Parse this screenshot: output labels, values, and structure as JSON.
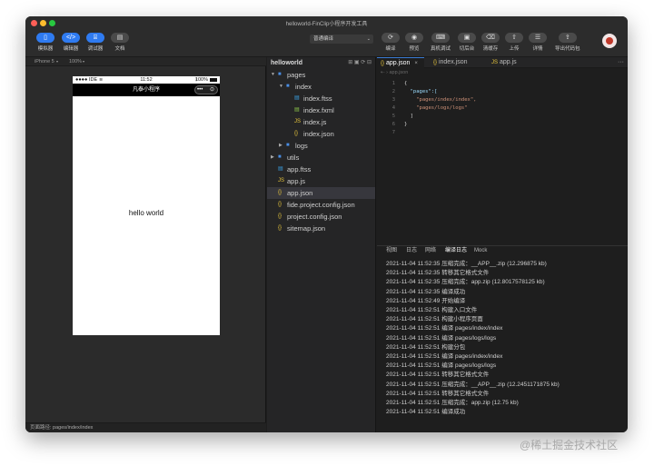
{
  "window": {
    "title": "helloworld-FinClip小程序开发工具"
  },
  "toolbar": {
    "left_buttons": [
      {
        "label": "模拟器",
        "icon": "phone-icon"
      },
      {
        "label": "编辑器",
        "icon": "code-icon"
      },
      {
        "label": "调试器",
        "icon": "debug-icon"
      },
      {
        "label": "文档",
        "icon": "doc-icon"
      }
    ],
    "compile_mode": "普通编译",
    "right_buttons": [
      {
        "label": "编译",
        "icon": "refresh-icon"
      },
      {
        "label": "预览",
        "icon": "eye-icon"
      },
      {
        "label": "真机调试",
        "icon": "device-icon"
      },
      {
        "label": "切后台",
        "icon": "background-icon"
      },
      {
        "label": "清缓存",
        "icon": "clear-icon"
      },
      {
        "label": "上传",
        "icon": "upload-icon"
      },
      {
        "label": "详情",
        "icon": "details-icon"
      },
      {
        "label": "导出代码包",
        "icon": "export-icon"
      }
    ]
  },
  "simulator": {
    "device": "iPhone 5",
    "zoom": "100%",
    "status_left": "IDE",
    "status_time": "11:52",
    "status_battery": "100%",
    "nav_title": "凡泰小程序",
    "body_text": "hello world",
    "footer_path": "页面路径: pages/index/index"
  },
  "explorer": {
    "project": "helloworld",
    "items": [
      {
        "name": "pages",
        "type": "folder",
        "indent": 0,
        "expanded": true
      },
      {
        "name": "index",
        "type": "folder",
        "indent": 1,
        "expanded": true
      },
      {
        "name": "index.ftss",
        "type": "css",
        "indent": 2
      },
      {
        "name": "index.fxml",
        "type": "xml",
        "indent": 2
      },
      {
        "name": "index.js",
        "type": "js",
        "indent": 2
      },
      {
        "name": "index.json",
        "type": "json",
        "indent": 2
      },
      {
        "name": "logs",
        "type": "folder",
        "indent": 1,
        "expanded": false
      },
      {
        "name": "utils",
        "type": "folder",
        "indent": 0,
        "expanded": false
      },
      {
        "name": "app.ftss",
        "type": "css",
        "indent": 0
      },
      {
        "name": "app.js",
        "type": "js",
        "indent": 0
      },
      {
        "name": "app.json",
        "type": "json",
        "indent": 0,
        "selected": true
      },
      {
        "name": "fide.project.config.json",
        "type": "json",
        "indent": 0
      },
      {
        "name": "project.config.json",
        "type": "json",
        "indent": 0
      },
      {
        "name": "sitemap.json",
        "type": "json",
        "indent": 0
      }
    ]
  },
  "editor": {
    "tabs": [
      {
        "label": "app.json",
        "active": true,
        "close": "×"
      },
      {
        "label": "index.json",
        "active": false
      },
      {
        "label": "app.js",
        "active": false
      }
    ],
    "breadcrumb": "app.json",
    "lines": [
      {
        "num": "1",
        "text": "{"
      },
      {
        "num": "2",
        "text": "  \"pages\":["
      },
      {
        "num": "3",
        "text": "    \"pages/index/index\","
      },
      {
        "num": "4",
        "text": "    \"pages/logs/logs\""
      },
      {
        "num": "5",
        "text": "  ]"
      },
      {
        "num": "6",
        "text": "}"
      },
      {
        "num": "7",
        "text": ""
      }
    ]
  },
  "console": {
    "tabs": [
      "视图",
      "日志",
      "网络",
      "编译日志",
      "Mock"
    ],
    "active_tab": "编译日志",
    "logs": [
      "2021-11-04 11:52:35 压缩完成：__APP__.zip (12.296875 kb)",
      "2021-11-04 11:52:35 转移其它格式文件",
      "2021-11-04 11:52:35 压缩完成：app.zip (12.8017578125 kb)",
      "2021-11-04 11:52:35 编译成功",
      "2021-11-04 11:52:49 开始编译",
      "2021-11-04 11:52:51 构建入口文件",
      "2021-11-04 11:52:51 构建小程序页面",
      "2021-11-04 11:52:51 编译 pages/index/index",
      "2021-11-04 11:52:51 编译 pages/logs/logs",
      "2021-11-04 11:52:51 构建分包",
      "2021-11-04 11:52:51 编译 pages/index/index",
      "2021-11-04 11:52:51 编译 pages/logs/logs",
      "2021-11-04 11:52:51 转移其它格式文件",
      "2021-11-04 11:52:51 压缩完成：__APP__.zip (12.2451171875 kb)",
      "2021-11-04 11:52:51 转移其它格式文件",
      "2021-11-04 11:52:51 压缩完成：app.zip (12.75 kb)",
      "2021-11-04 11:52:51 编译成功"
    ]
  },
  "watermark": "@稀土掘金技术社区",
  "colors": {
    "accent": "#2f7bf1",
    "folder": "#4a8fe7",
    "json": "#e8c63d",
    "js": "#e8c63d",
    "css": "#3a9ee0",
    "xml": "#8bc34a"
  }
}
